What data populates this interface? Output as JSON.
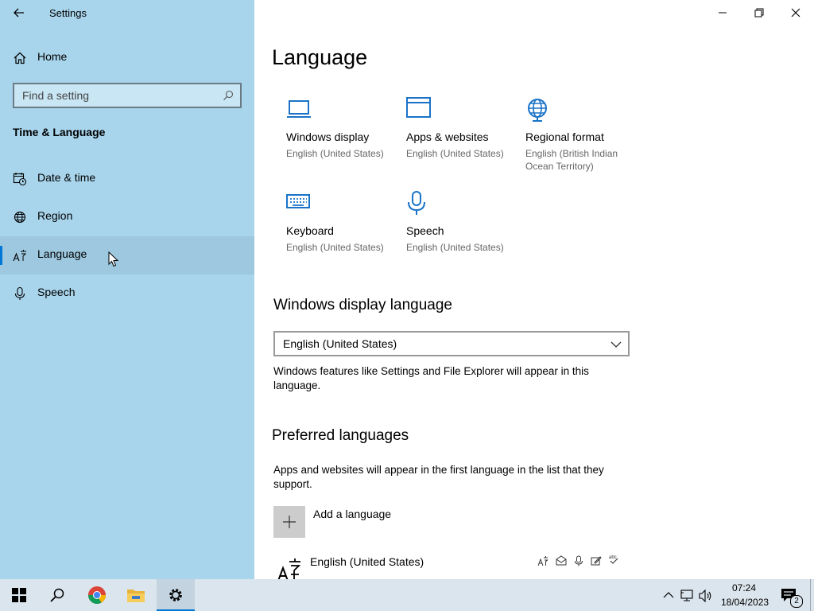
{
  "window": {
    "title": "Settings"
  },
  "sidebar": {
    "home_label": "Home",
    "search_placeholder": "Find a setting",
    "section_title": "Time & Language",
    "items": [
      {
        "label": "Date & time",
        "icon": "calendar-clock-icon"
      },
      {
        "label": "Region",
        "icon": "globe-icon"
      },
      {
        "label": "Language",
        "icon": "language-icon",
        "active": true
      },
      {
        "label": "Speech",
        "icon": "microphone-icon"
      }
    ]
  },
  "main": {
    "title": "Language",
    "tiles": [
      {
        "name": "Windows display",
        "sub": "English (United States)",
        "icon": "laptop-icon"
      },
      {
        "name": "Apps & websites",
        "sub": "English (United States)",
        "icon": "window-icon"
      },
      {
        "name": "Regional format",
        "sub": "English (British Indian Ocean Territory)",
        "icon": "globe-icon"
      },
      {
        "name": "Keyboard",
        "sub": "English (United States)",
        "icon": "keyboard-icon"
      },
      {
        "name": "Speech",
        "sub": "English (United States)",
        "icon": "microphone-icon"
      }
    ],
    "display_language": {
      "heading": "Windows display language",
      "selected": "English (United States)",
      "description": "Windows features like Settings and File Explorer will appear in this language."
    },
    "preferred": {
      "heading": "Preferred languages",
      "description": "Apps and websites will appear in the first language in the list that they support.",
      "add_label": "Add a language",
      "languages": [
        {
          "name": "English (United States)"
        }
      ]
    }
  },
  "taskbar": {
    "time": "07:24",
    "date": "18/04/2023",
    "notification_count": "2"
  },
  "colors": {
    "sidebar_bg": "#a8d5ec",
    "accent": "#0078d7",
    "icon_blue": "#1a73c8"
  }
}
